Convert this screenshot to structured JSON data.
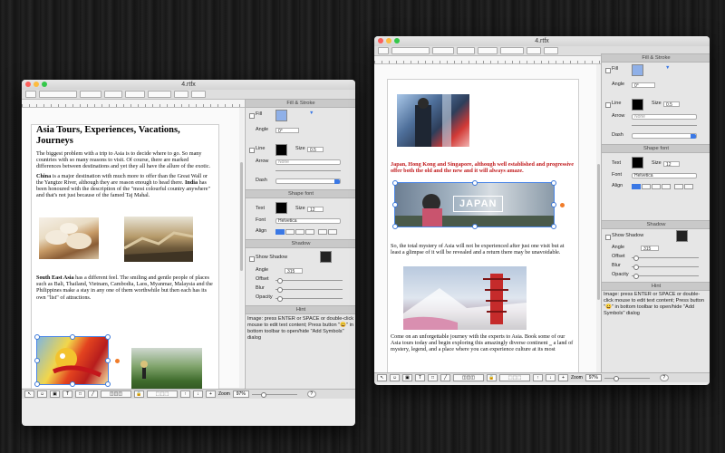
{
  "left_window": {
    "title": "4.rtfx",
    "page_title": "Asia Tours, Experiences, Vacations, Journeys",
    "para1": "The biggest problem with a trip to Asia is to decide where to go. So many countries with so many reasons to visit. Of course, there are marked differences between destinations and yet they all have the allure of the exotic.",
    "para2_bold": "China",
    "para2": " is a major destination with much more to offer than the Great Wall or the Yangtze River, although they are reason enough to head there. ",
    "para2_bold2": "India",
    "para2_rest": " has been honoured with the description of the \"most colourful country anywhere\" and that's not just because of the famed Taj Mahal.",
    "para3_bold": "South East Asia",
    "para3": " has a different feel. The smiling and gentle people of places such as Bali, Thailand, Vietnam, Cambodia, Laos, Myanmar, Malaysia and the Philippines make a stay in any one of them worthwhile but then each has its own \"list\" of attractions.",
    "zoom_label": "Zoom",
    "zoom_value": "97%",
    "help": "?"
  },
  "right_window": {
    "title": "4.rtfx",
    "red_text": "Japan, Hong Kong and Singapore, although well established and progressive offer both the old and the new and it will always amaze.",
    "japan_banner": "JAPAN",
    "para_a": "So, the total mystery of Asia will not be experienced after just one visit but at least a glimpse of it will be revealed and a return there may be unavoidable.",
    "para_b": "Come on an unforgettable journey with the experts to Asia. Book some of our Asia tours today and begin exploring this amazingly diverse continent ‗ a land of mystery, legend, and a place where you can experience culture at its most",
    "zoom_label": "Zoom",
    "zoom_value": "97%",
    "help": "?"
  },
  "inspector": {
    "fill_stroke": "Fill & Stroke",
    "fill": "Fill",
    "angle": "Angle",
    "angle_value": "0°",
    "line": "Line",
    "size": "Size",
    "size_value": "0.5",
    "arrow": "Arrow",
    "arrow_value": "None",
    "dash": "Dash",
    "shape_font": "Shape font",
    "text": "Text",
    "font": "Font",
    "font_value": "Helvetica",
    "font_size": "12",
    "align": "Align",
    "shadow": "Shadow",
    "show_shadow": "Show Shadow",
    "shadow_angle": "Angle",
    "shadow_angle_value": "315",
    "offset": "Offset",
    "blur": "Blur",
    "opacity": "Opacity",
    "hint": "Hint",
    "hint_text": "Image: press ENTER or SPACE or double-click mouse to edit text content;  Press button \"😀\" in bottom toolbar to open/hide \"Add Symbols\" dialog"
  }
}
